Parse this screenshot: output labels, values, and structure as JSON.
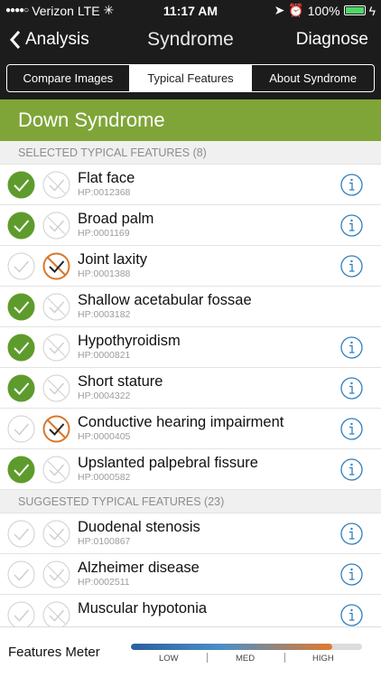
{
  "status": {
    "carrier": "Verizon",
    "network": "LTE",
    "time": "11:17 AM",
    "battery": "100%"
  },
  "nav": {
    "back_label": "Analysis",
    "title": "Syndrome",
    "action_label": "Diagnose"
  },
  "tabs": [
    {
      "label": "Compare Images",
      "active": false
    },
    {
      "label": "Typical Features",
      "active": true
    },
    {
      "label": "About Syndrome",
      "active": false
    }
  ],
  "syndrome": {
    "name": "Down Syndrome"
  },
  "selected_section": {
    "title": "SELECTED TYPICAL FEATURES (8)"
  },
  "selected_features": [
    {
      "name": "Flat face",
      "hp": "HP:0012368",
      "state": "present",
      "info": true
    },
    {
      "name": "Broad palm",
      "hp": "HP:0001169",
      "state": "present",
      "info": true
    },
    {
      "name": "Joint laxity",
      "hp": "HP:0001388",
      "state": "absent",
      "info": true
    },
    {
      "name": "Shallow acetabular fossae",
      "hp": "HP:0003182",
      "state": "present",
      "info": false
    },
    {
      "name": "Hypothyroidism",
      "hp": "HP:0000821",
      "state": "present",
      "info": true
    },
    {
      "name": "Short stature",
      "hp": "HP:0004322",
      "state": "present",
      "info": true
    },
    {
      "name": "Conductive hearing impairment",
      "hp": "HP:0000405",
      "state": "absent",
      "info": true
    },
    {
      "name": "Upslanted palpebral fissure",
      "hp": "HP:0000582",
      "state": "present",
      "info": true
    }
  ],
  "suggested_section": {
    "title": "SUGGESTED TYPICAL FEATURES (23)"
  },
  "suggested_features": [
    {
      "name": "Duodenal stenosis",
      "hp": "HP:0100867",
      "state": "none",
      "info": true
    },
    {
      "name": "Alzheimer disease",
      "hp": "HP:0002511",
      "state": "none",
      "info": true
    },
    {
      "name": "Muscular hypotonia",
      "hp": "",
      "state": "none",
      "info": true
    }
  ],
  "meter": {
    "label": "Features Meter",
    "level_low": "LOW",
    "level_med": "MED",
    "level_high": "HIGH",
    "fill_fraction": 0.87
  },
  "colors": {
    "accent_green": "#7fa538",
    "present_green": "#5e9b2d",
    "absent_orange": "#d9772a",
    "info_blue": "#2f7fbf"
  }
}
